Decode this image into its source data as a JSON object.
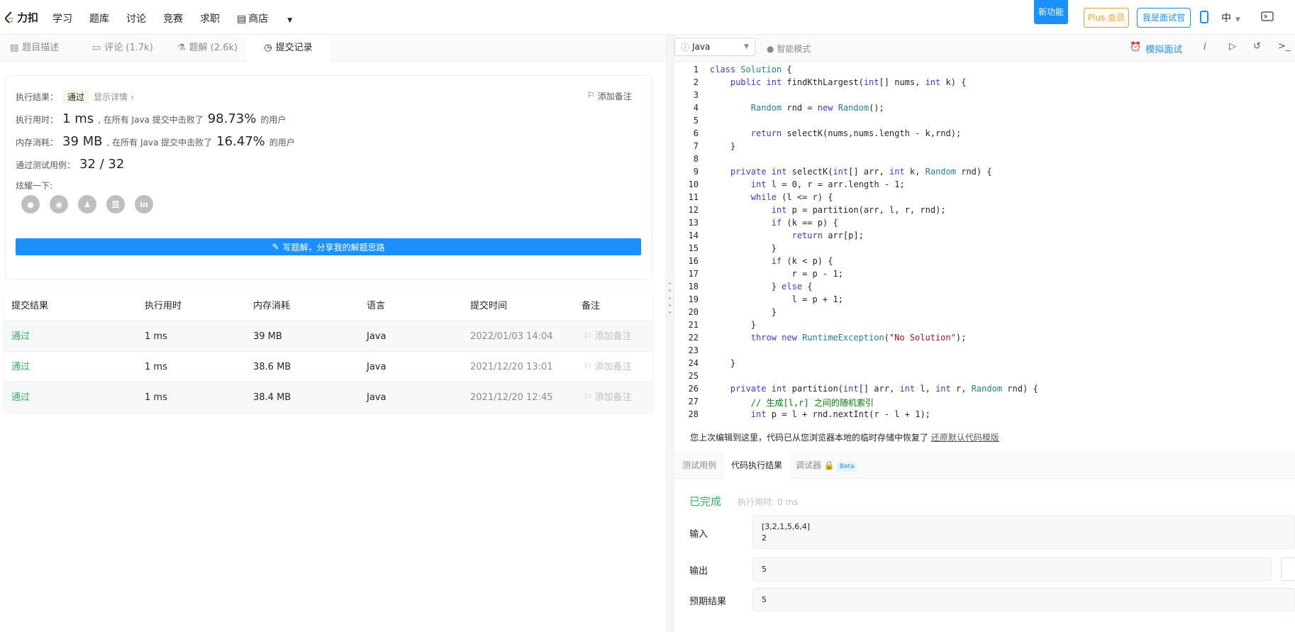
{
  "top": {
    "logo_text": "力扣",
    "nav": [
      "学习",
      "题库",
      "讨论",
      "竞赛",
      "求职",
      "商店"
    ],
    "new_feature": "新功能",
    "plus": "Plus 会员",
    "interviewer": "我是面试官",
    "lang": "中"
  },
  "tabs": [
    {
      "label": "题目描述"
    },
    {
      "label": "评论 (1.7k)"
    },
    {
      "label": "题解 (2.6k)"
    },
    {
      "label": "提交记录"
    }
  ],
  "result": {
    "status_label": "执行结果：",
    "status": "通过",
    "details": "显示详情",
    "add_note": "添加备注",
    "time_label": "执行用时：",
    "time_value": "1 ms",
    "time_mid": ", 在所有 Java 提交中击败了",
    "time_pct": "98.73%",
    "users": "的用户",
    "mem_label": "内存消耗：",
    "mem_value": "39 MB",
    "mem_mid": ", 在所有 Java 提交中击败了",
    "mem_pct": "16.47%",
    "cases_label": "通过测试用例：",
    "cases_value": "32 / 32",
    "share_label": "炫耀一下:",
    "write_button": "写题解，分享我的解题思路"
  },
  "table": {
    "headers": [
      "提交结果",
      "执行用时",
      "内存消耗",
      "语言",
      "提交时间",
      "备注"
    ],
    "rows": [
      {
        "result": "通过",
        "time": "1 ms",
        "memory": "39 MB",
        "lang": "Java",
        "submitted": "2022/01/03 14:04",
        "note": "添加备注"
      },
      {
        "result": "通过",
        "time": "1 ms",
        "memory": "38.6 MB",
        "lang": "Java",
        "submitted": "2021/12/20 13:01",
        "note": "添加备注"
      },
      {
        "result": "通过",
        "time": "1 ms",
        "memory": "38.4 MB",
        "lang": "Java",
        "submitted": "2021/12/20 12:45",
        "note": "添加备注"
      }
    ]
  },
  "editor": {
    "language": "Java",
    "smart_mode": "智能模式",
    "mock_interview": "模拟面试",
    "lines": [
      "class Solution {",
      "    public int findKthLargest(int[] nums, int k) {",
      "",
      "        Random rnd = new Random();",
      "",
      "        return selectK(nums,nums.length - k,rnd);",
      "    }",
      "",
      "    private int selectK(int[] arr, int k, Random rnd) {",
      "        int l = 0, r = arr.length - 1;",
      "        while (l <= r) {",
      "            int p = partition(arr, l, r, rnd);",
      "            if (k == p) {",
      "                return arr[p];",
      "            }",
      "            if (k < p) {",
      "                r = p - 1;",
      "            } else {",
      "                l = p + 1;",
      "            }",
      "        }",
      "        throw new RuntimeException(\"No Solution\");",
      "",
      "    }",
      "",
      "    private int partition(int[] arr, int l, int r, Random rnd) {",
      "        // 生成[l,r] 之间的随机索引",
      "        int p = l + rnd.nextInt(r - l + 1);"
    ]
  },
  "restore": {
    "text": "您上次编辑到这里，代码已从您浏览器本地的临时存储中恢复了",
    "link": "还原默认代码模版"
  },
  "bottom_tabs": [
    "测试用例",
    "代码执行结果",
    "调试器"
  ],
  "beta": "Beta",
  "run": {
    "status": "已完成",
    "exec_time": "执行用时: 0 ms",
    "input_label": "输入",
    "input_line1": "[3,2,1,5,6,4]",
    "input_line2": "2",
    "output_label": "输出",
    "output_value": "5",
    "expected_label": "预期结果",
    "expected_value": "5"
  },
  "colors": {
    "accent": "#1a90ff",
    "pass": "#2db55d",
    "shop": "#f0a020"
  }
}
